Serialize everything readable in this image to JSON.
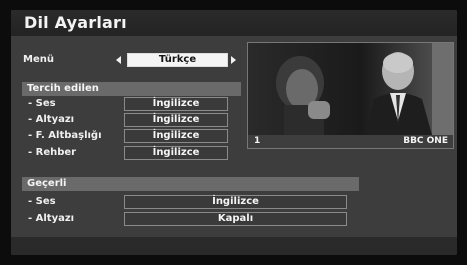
{
  "header": {
    "title": "Dil Ayarları"
  },
  "menu_row": {
    "label": "Menü",
    "value": "Türkçe"
  },
  "preferred": {
    "section_title": "Tercih edilen",
    "rows": [
      {
        "label": "- Ses",
        "value": "İngilizce"
      },
      {
        "label": "- Altyazı",
        "value": "İngilizce"
      },
      {
        "label": "- F. Altbaşlığı",
        "value": "İngilizce"
      },
      {
        "label": "- Rehber",
        "value": "İngilizce"
      }
    ]
  },
  "current": {
    "section_title": "Geçerli",
    "rows": [
      {
        "label": "- Ses",
        "value": "İngilizce"
      },
      {
        "label": "- Altyazı",
        "value": "Kapalı"
      }
    ]
  },
  "preview": {
    "channel_number": "1",
    "channel_name": "BBC ONE"
  },
  "colors": {
    "panel_bg": "#3d3d3d",
    "section_bar": "#6a6a6a",
    "selected_box": "#f4f4f4"
  }
}
